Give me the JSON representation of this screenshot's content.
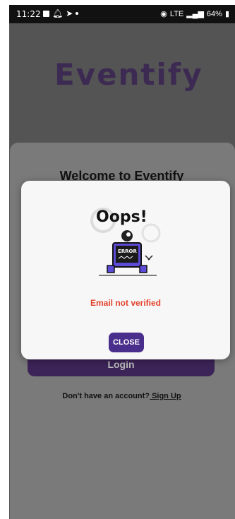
{
  "status_bar": {
    "time": "11:22",
    "battery": "64%",
    "network_label": "LTE"
  },
  "app": {
    "logo_text": "Eventify",
    "welcome_title": "Welcome to Eventify",
    "login_label": "Login",
    "signup_prompt": "Don't have an account?",
    "signup_link": " Sign Up"
  },
  "dialog": {
    "oops_text": "Oops!",
    "error_badge": "ERROR",
    "message": "Email not verified",
    "close_label": "CLOSE"
  },
  "colors": {
    "accent_purple": "#4a2e8c",
    "error_red": "#e3412a",
    "overlay_gray": "#545454"
  }
}
